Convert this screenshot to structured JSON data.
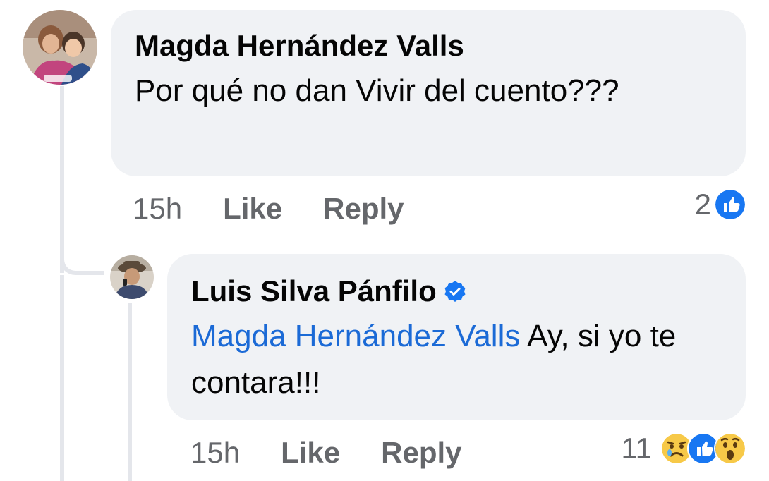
{
  "comments": [
    {
      "author": "Magda Hernández Valls",
      "text": "Por qué no dan Vivir del cuento???",
      "time": "15h",
      "like_label": "Like",
      "reply_label": "Reply",
      "reaction_count": "2",
      "reactions": [
        "like-icon"
      ]
    },
    {
      "author": "Luis Silva Pánfilo",
      "verified": true,
      "mention": "Magda Hernández Valls",
      "text": " Ay, si yo te contara!!!",
      "time": "15h",
      "like_label": "Like",
      "reply_label": "Reply",
      "reaction_count": "11",
      "reactions": [
        "sad-icon",
        "like-icon",
        "wow-icon"
      ]
    }
  ],
  "colors": {
    "bubble": "#f0f2f5",
    "mention": "#1b6ad6",
    "meta": "#65676b",
    "like_blue": "#1877f2",
    "emoji_yellow": "#f7c948"
  }
}
